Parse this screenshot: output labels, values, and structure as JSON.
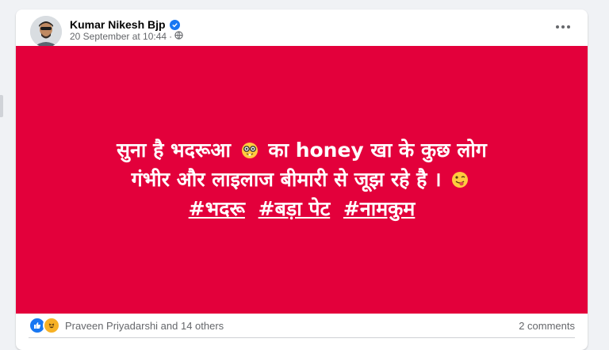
{
  "post": {
    "author": "Kumar Nikesh Bjp",
    "timestamp": "20 September at 10:44",
    "separator": "·",
    "privacy_icon": "globe-icon",
    "verified_icon": "verified-badge-icon",
    "more_icon": "more-options-icon"
  },
  "content": {
    "background_color": "#e3003b",
    "line1_start": "सुना है भदरूआ",
    "line1_emoji": "nerd-face-emoji",
    "line1_end": "का honey खा के कुछ लोग",
    "line2": "गंभीर और लाइलाज बीमारी से जूझ रहे है ।",
    "line2_emoji": "winking-tongue-emoji",
    "hashtags": [
      "#भदरू",
      "#बड़ा पेट",
      "#नामकुम"
    ]
  },
  "footer": {
    "reactions_text": "Praveen Priyadarshi and 14 others",
    "comments_text": "2 comments",
    "reaction_icons": [
      "like-icon",
      "haha-icon"
    ]
  },
  "colors": {
    "accent": "#1877f2",
    "card_bg": "#ffffff",
    "page_bg": "#f0f2f5"
  }
}
